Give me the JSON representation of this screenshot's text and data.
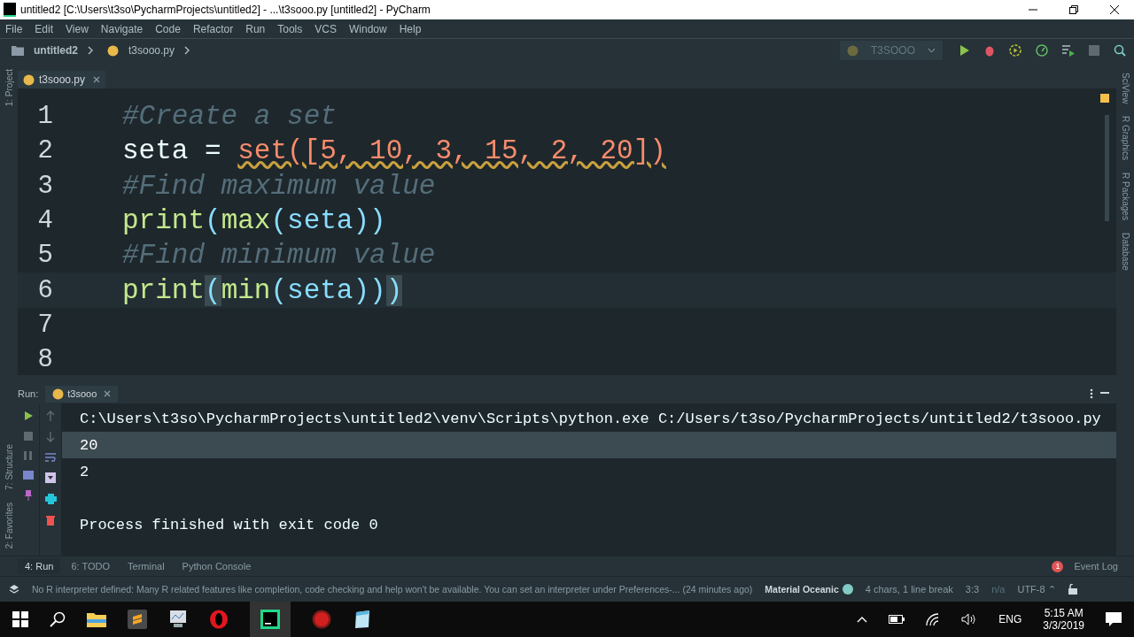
{
  "window": {
    "title": "untitled2 [C:\\Users\\t3so\\PycharmProjects\\untitled2] - ...\\t3sooo.py [untitled2] - PyCharm"
  },
  "menu": [
    "File",
    "Edit",
    "View",
    "Navigate",
    "Code",
    "Refactor",
    "Run",
    "Tools",
    "VCS",
    "Window",
    "Help"
  ],
  "breadcrumb": [
    "untitled2",
    "t3sooo.py"
  ],
  "run_config": {
    "label": "T3SOOO"
  },
  "left_tools_top": [
    "1: Project"
  ],
  "left_tools_bottom": [
    "7: Structure",
    "2: Favorites"
  ],
  "right_tools": [
    "SciView",
    "R Graphics",
    "R Packages",
    "Database"
  ],
  "editor_tabs": [
    {
      "label": "t3sooo.py",
      "selected": true
    }
  ],
  "code": [
    {
      "number": "1",
      "tokens": [
        {
          "text": "#Create a set",
          "kind": "comment"
        }
      ]
    },
    {
      "number": "2",
      "tokens": [
        {
          "text": "seta = ",
          "kind": "plain"
        },
        {
          "text": "set([5, 10, 3, 15, 2, 20])",
          "kind": "warn"
        }
      ]
    },
    {
      "number": "3",
      "tokens": [
        {
          "text": "#Find maximum value",
          "kind": "comment"
        }
      ]
    },
    {
      "number": "4",
      "tokens": [
        {
          "text": "print",
          "kind": "func"
        },
        {
          "text": "(",
          "kind": "plain"
        },
        {
          "text": "max",
          "kind": "func"
        },
        {
          "text": "(seta))",
          "kind": "plain"
        }
      ]
    },
    {
      "number": "5",
      "tokens": [
        {
          "text": "#Find minimum value",
          "kind": "comment"
        }
      ]
    },
    {
      "number": "6",
      "tokens": [
        {
          "text": "print",
          "kind": "func"
        },
        {
          "text": "(",
          "kind": "match"
        },
        {
          "text": "min",
          "kind": "func"
        },
        {
          "text": "(seta))",
          "kind": "plain"
        },
        {
          "text": ")",
          "kind": "match"
        }
      ]
    },
    {
      "number": "7"
    },
    {
      "number": "8"
    }
  ],
  "run_panel": {
    "label": "Run:",
    "tabs": [
      {
        "label": "t3sooo",
        "selected": true
      }
    ],
    "output": [
      {
        "text": "C:\\Users\\t3so\\PycharmProjects\\untitled2\\venv\\Scripts\\python.exe C:/Users/t3so/PycharmProjects/untitled2/t3sooo.py",
        "selected": false
      },
      {
        "text": "20",
        "selected": true
      },
      {
        "text": "2",
        "selected": false
      },
      {
        "text": "Process finished with exit code 0",
        "selected": false
      }
    ]
  },
  "tool_tabs": [
    {
      "label": "4: Run",
      "selected": true
    },
    {
      "label": "6: TODO",
      "selected": false
    },
    {
      "label": "Terminal",
      "selected": false
    },
    {
      "label": "Python Console",
      "selected": false
    }
  ],
  "event_log": {
    "count": "1",
    "label": "Event Log"
  },
  "status_bar": {
    "message": "No R interpreter defined: Many R related features like completion, code checking and help won't be available. You can set an interpreter under Preferences-... (24 minutes ago)",
    "theme": "Material Oceanic",
    "selection": "4 chars, 1 line break",
    "position": "3:3",
    "indent": "n/a",
    "encoding": "UTF-8 ⌃"
  },
  "taskbar": {
    "language": "ENG",
    "time": "5:15 AM",
    "date": "3/3/2019"
  }
}
